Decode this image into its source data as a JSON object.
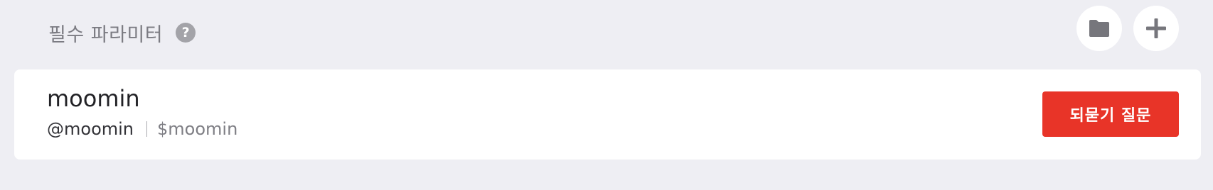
{
  "header": {
    "title": "필수 파라미터",
    "help_glyph": "?",
    "actions": [
      {
        "icon": "folder-icon"
      },
      {
        "icon": "plus-icon"
      }
    ]
  },
  "parameter": {
    "name": "moomin",
    "mention": "@moomin",
    "variable": "$moomin",
    "reprompt_label": "되묻기 질문"
  },
  "colors": {
    "background": "#eeeef3",
    "accent": "#e83428",
    "icon_gray": "#76767c"
  }
}
